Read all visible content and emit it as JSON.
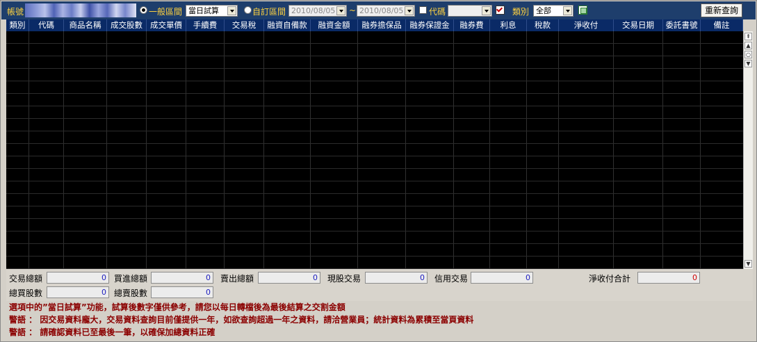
{
  "toolbar": {
    "account_label": "帳號",
    "range_normal_label": "一般區間",
    "range_normal_selected": true,
    "period_value": "當日試算",
    "range_custom_label": "自訂區間",
    "range_custom_selected": false,
    "date_from": "2010/08/05",
    "date_sep": "~",
    "date_to": "2010/08/05",
    "code_label": "代碼",
    "code_checked": false,
    "code_value": "",
    "filter_checked": true,
    "category_label": "類別",
    "category_value": "全部",
    "requery_label": "重新查詢"
  },
  "grid": {
    "columns": [
      "類別",
      "代碼",
      "商品名稱",
      "成交股數",
      "成交單價",
      "手續費",
      "交易稅",
      "融資自備款",
      "融資金額",
      "融券擔保品",
      "融券保證金",
      "融券費",
      "利息",
      "稅款",
      "淨收付",
      "交易日期",
      "委託書號",
      "備註"
    ],
    "rows": []
  },
  "summary": {
    "trade_total_label": "交易總額",
    "trade_total": "0",
    "buy_total_label": "買進總額",
    "buy_total": "0",
    "sell_total_label": "賣出總額",
    "sell_total": "0",
    "cash_trade_label": "現股交易",
    "cash_trade": "0",
    "credit_trade_label": "信用交易",
    "credit_trade": "0",
    "net_total_label": "淨收付合計",
    "net_total": "0",
    "buy_shares_label": "總買股數",
    "buy_shares": "0",
    "sell_shares_label": "總賣股數",
    "sell_shares": "0"
  },
  "notes": {
    "line1": "選項中的”當日試算”功能，試算後數字僅供參考，請您以每日轉檔後為最後結算之交割金額",
    "line2": "警語 ： 因交易資料龐大，交易資料查詢目前僅提供一年，如欲查詢超過一年之資料，請洽營業員；統計資料為累積至當頁資料",
    "line3": "警語 ： 請確認資料已至最後一筆，以確保加總資料正確"
  },
  "colors": {
    "toolbar_bg": "#1e3e6c",
    "header_bg": "#0a2a66",
    "label_yellow": "#ffd23f",
    "grid_bg": "#000000",
    "note_red": "#8b0000",
    "value_blue": "#2020c0",
    "value_red": "#d00000"
  }
}
